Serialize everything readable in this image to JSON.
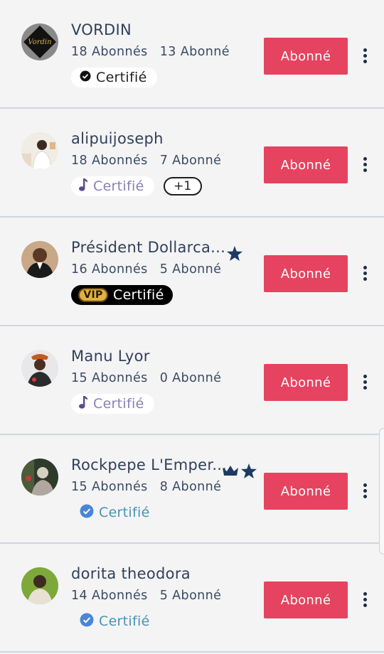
{
  "follow_button_label": "Abonné",
  "rows": [
    {
      "name": "VORDIN",
      "followers": "18 Abonnés",
      "following": "13 Abonné",
      "badge": "Certifié",
      "avatar_text": "Vordin"
    },
    {
      "name": "alipuijoseph",
      "followers": "18 Abonnés",
      "following": "7 Abonné",
      "badge": "Certifié",
      "extra": "+1"
    },
    {
      "name": "Président Dollarca...",
      "followers": "16 Abonnés",
      "following": "5 Abonné",
      "badge": "Certifié",
      "vip": "VIP"
    },
    {
      "name": "Manu Lyor",
      "followers": "15 Abonnés",
      "following": "0 Abonné",
      "badge": "Certifié"
    },
    {
      "name": "Rockpepe L'Emper...",
      "followers": "15 Abonnés",
      "following": "8 Abonné",
      "badge": "Certifié"
    },
    {
      "name": "dorita theodora",
      "followers": "14 Abonnés",
      "following": "5 Abonné",
      "badge": "Certifié"
    }
  ],
  "colors": {
    "button": "#e5435f",
    "name_text": "#31405a",
    "certified_blue": "#4a93b3",
    "music_purple": "#8a7fb8",
    "star_navy": "#1c3a63"
  },
  "icons": {
    "check_badge": "check-circle-icon",
    "music": "music-note-icon",
    "verified": "verified-blue-icon",
    "star": "star-icon",
    "crown": "crown-icon",
    "more": "more-vertical-icon"
  }
}
